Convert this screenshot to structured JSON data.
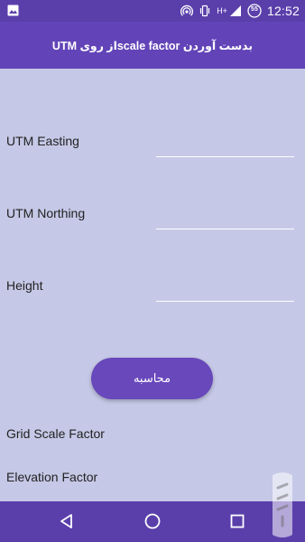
{
  "status_bar": {
    "time": "12:52",
    "battery_level": "55",
    "signal_text": "H+",
    "icons": [
      "image-icon",
      "hotspot-icon",
      "vibrate-icon",
      "signal-icon",
      "battery-icon"
    ]
  },
  "app_bar": {
    "title": "بدست آوردن scale factorاز روی UTM"
  },
  "form": {
    "easting_label": "UTM Easting",
    "easting_value": "",
    "northing_label": "UTM Northing",
    "northing_value": "",
    "height_label": "Height",
    "height_value": "",
    "calculate_label": "محاسبه"
  },
  "results": {
    "grid_scale_label": "Grid Scale Factor",
    "elevation_label": "Elevation Factor"
  },
  "nav": {
    "icons": [
      "back-icon",
      "home-icon",
      "recents-icon"
    ]
  },
  "colors": {
    "primary": "#6244b8",
    "primary_dark": "#5a3fab",
    "background": "#c5c8e6",
    "button": "#6848bb"
  }
}
